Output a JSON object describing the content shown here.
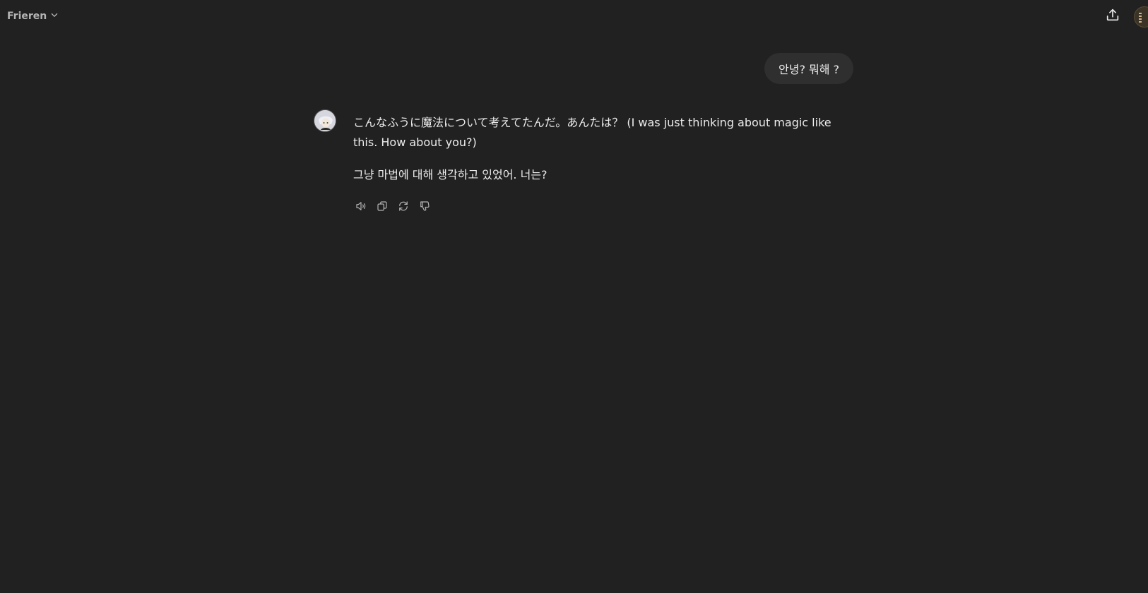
{
  "header": {
    "model_name": "Frieren",
    "chevron_icon": "chevron-down-icon",
    "share_icon": "share-upload-icon"
  },
  "conversation": {
    "user_message": "안녕? 뭐해 ?",
    "assistant_paragraphs": [
      "こんなふうに魔法について考えてたんだ。あんたは？ (I was just thinking about magic like this. How about you?)",
      "그냥 마법에 대해 생각하고 있었어. 너는?"
    ],
    "actions": [
      {
        "icon": "speaker-icon"
      },
      {
        "icon": "copy-icon"
      },
      {
        "icon": "regenerate-icon"
      },
      {
        "icon": "thumbs-down-icon"
      }
    ]
  },
  "colors": {
    "background": "#212121",
    "bubble": "#2f2f2f",
    "text": "#ececec",
    "muted": "#b4b4b4"
  }
}
